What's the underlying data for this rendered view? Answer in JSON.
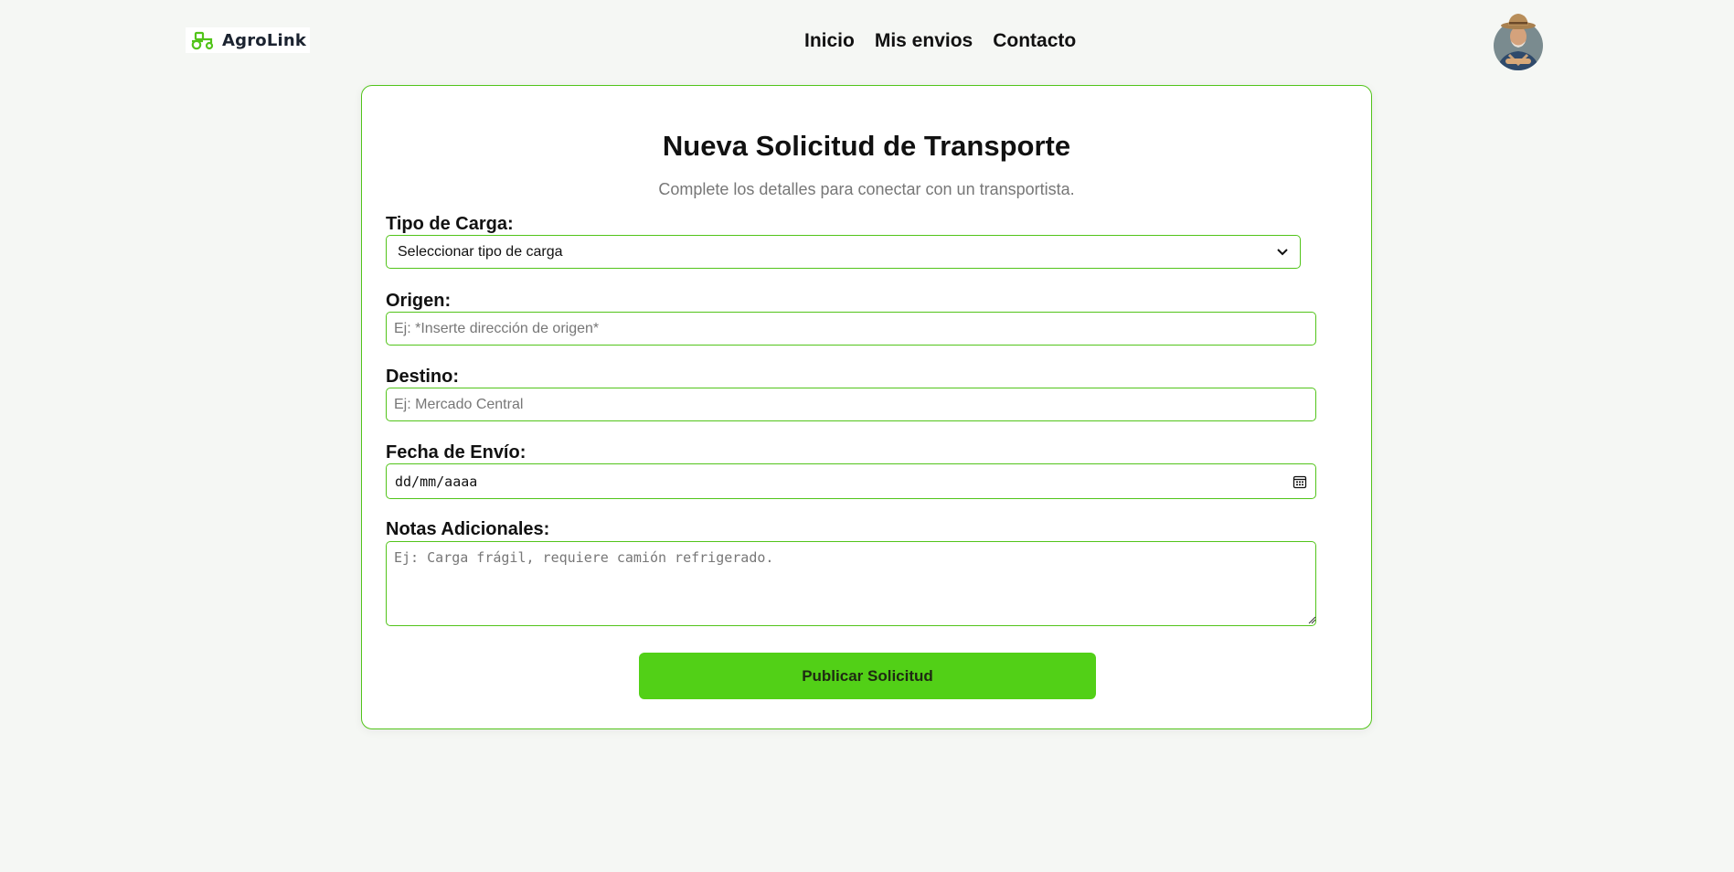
{
  "header": {
    "logo_text": "AgroLink",
    "nav": [
      {
        "label": "Inicio"
      },
      {
        "label": "Mis envios"
      },
      {
        "label": "Contacto"
      }
    ],
    "avatar_icon": "farmer-avatar"
  },
  "form": {
    "title": "Nueva Solicitud de Transporte",
    "subtitle": "Complete los detalles para conectar con un transportista.",
    "cargo_type": {
      "label": "Tipo de Carga:",
      "selected": "Seleccionar tipo de carga"
    },
    "origin": {
      "label": "Origen:",
      "placeholder": "Ej: *Inserte dirección de origen*",
      "value": ""
    },
    "destination": {
      "label": "Destino:",
      "placeholder": "Ej: Mercado Central",
      "value": ""
    },
    "ship_date": {
      "label": "Fecha de Envío:",
      "placeholder": "dd/mm/aaaa"
    },
    "notes": {
      "label": "Notas Adicionales:",
      "placeholder": "Ej: Carga frágil, requiere camión refrigerado."
    },
    "submit_label": "Publicar Solicitud"
  },
  "colors": {
    "accent": "#52c41a",
    "button": "#52d017",
    "background": "#f5f7f4"
  }
}
